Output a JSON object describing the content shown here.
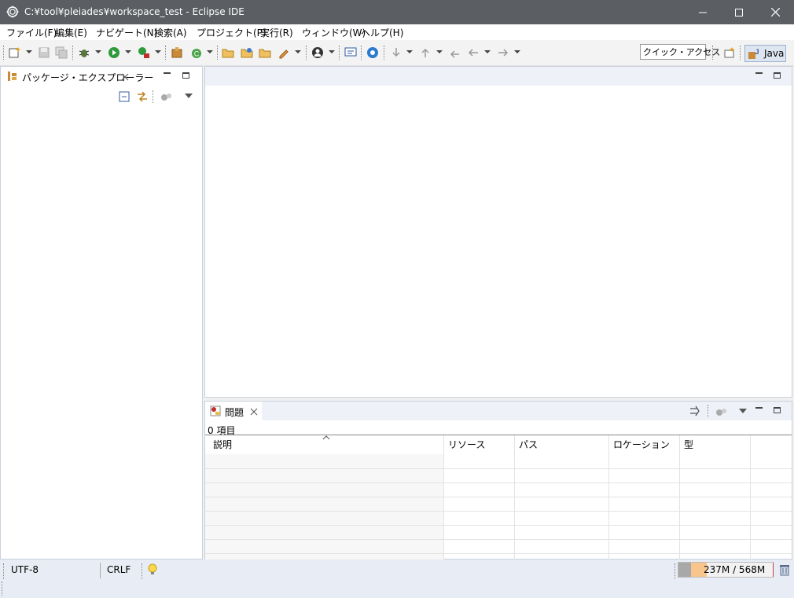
{
  "window": {
    "title": "C:¥tool¥pleiades¥workspace_test - Eclipse IDE",
    "buttons": [
      "minimize",
      "maximize",
      "close"
    ]
  },
  "menubar": {
    "items": [
      "ファイル(F)",
      "編集(E)",
      "ナビゲート(N)",
      "検索(A)",
      "プロジェクト(P)",
      "実行(R)",
      "ウィンドウ(W)",
      "ヘルプ(H)"
    ]
  },
  "toolbar": {
    "quick_access": "クイック・アクセス",
    "perspective": "Java"
  },
  "package_explorer": {
    "title": "パッケージ・エクスプローラー"
  },
  "problems": {
    "title": "問題",
    "count": "0 項目",
    "columns": [
      "説明",
      "リソース",
      "パス",
      "ロケーション",
      "型"
    ]
  },
  "statusbar": {
    "encoding": "UTF-8",
    "line_ending": "CRLF",
    "memory": "237M / 568M"
  },
  "colors": {
    "title_bar": "#5b5f63",
    "panel_header": "#eef2f8",
    "status_bar": "#e8ecf4",
    "heap_used": "#f8c58c"
  }
}
